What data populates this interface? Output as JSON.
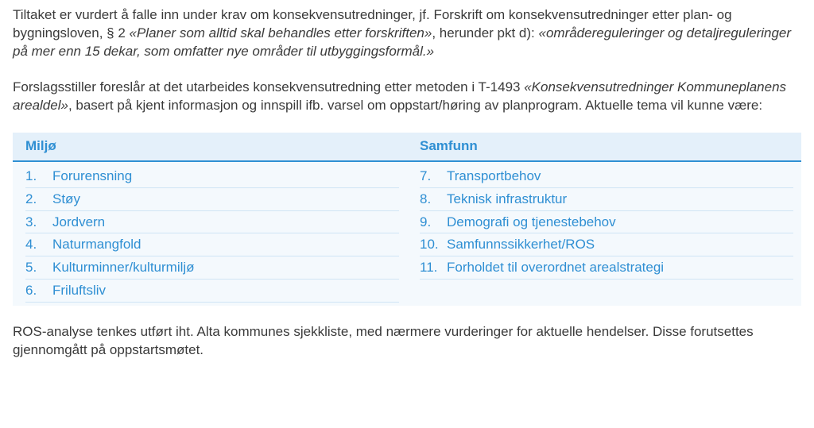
{
  "paragraph1": {
    "t1": "Tiltaket er vurdert å falle inn under krav om konsekvensutredninger, jf. Forskrift om konsekvensutred­ninger etter plan- og bygningsloven, § 2 ",
    "t2": "«Planer som alltid skal behandles etter forskriften»",
    "t3": ", herunder pkt d): ",
    "t4": "«områdereguleringer og detaljreguleringer på mer enn 15 dekar, som omfatter nye områder til utbyggingsformål.»"
  },
  "paragraph2": {
    "t1": "Forslagsstiller foreslår at det utarbeides konsekvensutredning etter metoden i T-1493 ",
    "t2": "«Konsekvensut­redninger Kommuneplanens arealdel»",
    "t3": ", basert på kjent informasjon og innspill ifb. varsel om opp­start/høring av planprogram. Aktuelle tema vil kunne være:"
  },
  "table": {
    "col1_header": "Miljø",
    "col2_header": "Samfunn",
    "col1": [
      {
        "n": "1.",
        "label": "Forurensning"
      },
      {
        "n": "2.",
        "label": "Støy"
      },
      {
        "n": "3.",
        "label": "Jordvern"
      },
      {
        "n": "4.",
        "label": "Naturmangfold"
      },
      {
        "n": "5.",
        "label": "Kulturminner/kulturmiljø"
      },
      {
        "n": "6.",
        "label": "Friluftsliv"
      }
    ],
    "col2": [
      {
        "n": "7.",
        "label": "Transportbehov"
      },
      {
        "n": "8.",
        "label": "Teknisk infrastruktur"
      },
      {
        "n": "9.",
        "label": "Demografi og tjenestebehov"
      },
      {
        "n": "10.",
        "label": "Samfunnssikkerhet/ROS"
      },
      {
        "n": "11.",
        "label": "Forholdet til overordnet arealstrategi"
      }
    ]
  },
  "paragraph3": "ROS-analyse tenkes utført iht. Alta kommunes sjekkliste, med nærmere vurderinger for aktuelle hendel­ser. Disse forutsettes gjennomgått på oppstartsmøtet."
}
